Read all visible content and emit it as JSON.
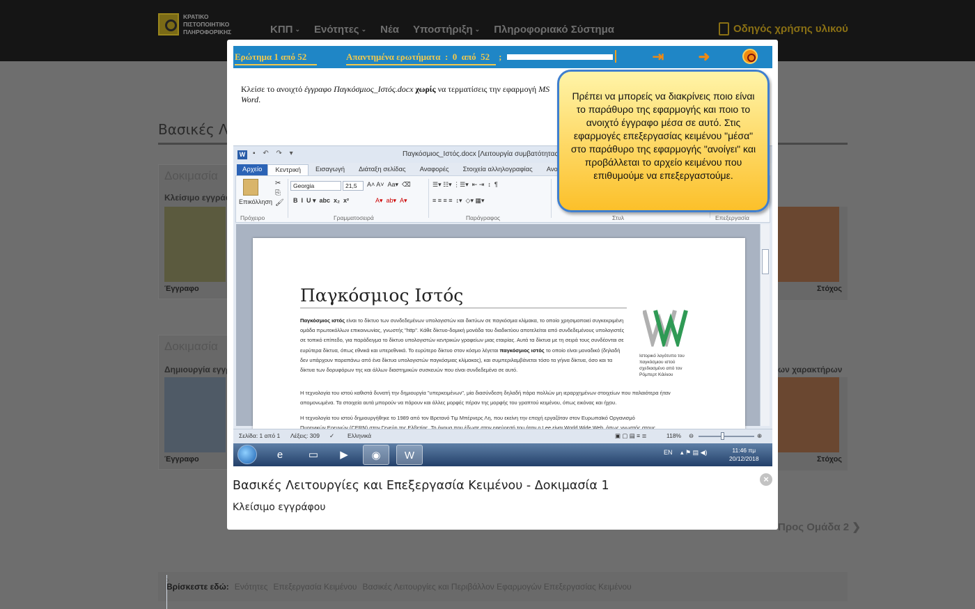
{
  "site": {
    "logo_text": "ΚΡΑΤΙΚΟ\nΠΙΣΤΟΠΟΙΗΤΙΚΟ\nΠΛΗΡΟΦΟΡΙΚΗΣ",
    "nav": [
      "ΚΠΠ",
      "Ενότητες",
      "Νέα",
      "Υποστήριξη",
      "Πληροφοριακό Σύστημα"
    ],
    "guide": "Οδηγός χρήσης υλικού",
    "section_title": "Βασικές Λε",
    "cards": [
      {
        "title": "Δοκιμασία",
        "subtitle": "Κλείσιμο εγγράφ",
        "footer": "Έγγραφο",
        "right_footer": "Στόχος"
      },
      {
        "title": "Δοκιμασία",
        "subtitle": "Δημιουργία εγγρ",
        "footer": "Έγγραφο",
        "right_label": "ων χαρακτήρων",
        "right_footer": "Στόχος"
      }
    ],
    "next_group": "Προς Ομάδα 2",
    "breadcrumb": {
      "label": "Βρίσκεστε εδώ:",
      "items": [
        "Ενότητες",
        "Επεξεργασία Κειμένου",
        "Βασικές Λειτουργίες και Περιβάλλον Εφαρμογών Επεξεργασίας Κειμένου"
      ]
    }
  },
  "modal": {
    "title": "Βασικές Λειτουργίες και Επεξεργασία Κειμένου - Δοκιμασία 1",
    "subtitle": "Κλείσιμο εγγράφου",
    "close_icon": "close-circle-icon",
    "quiz": {
      "question": "Ερώτημα 1 από 52",
      "answered": "Απαντημένα ερωτήματα  :  0  από  52    ;",
      "progress": 0,
      "instruction_pre": "Κλείσε το ανοιχτό ",
      "instruction_doc_word": "έγγραφο",
      "instruction_file": "Παγκόσμιος_Ιστός.docx",
      "instruction_bold": "χωρίς",
      "instruction_post": " να τερματίσεις την εφαρμογή ",
      "instruction_app": "MS Word",
      "tooltip": "Πρέπει να μπορείς να διακρίνεις ποιο είναι το παράθυρο της εφαρμογής και ποιο το ανοιχτό έγγραφο μέσα σε αυτό. Στις εφαρμογές επεξεργασίας κειμένου \"μέσα\" στο παράθυρο της εφαρμογής \"ανοίγει\" και προβάλλεται το αρχείο κειμένου που επιθυμούμε να επεξεργαστούμε."
    },
    "word": {
      "window_title": "Παγκόσμιος_Ιστός.docx [Λειτουργία συμβατότητας] -",
      "tabs": [
        "Αρχείο",
        "Κεντρική",
        "Εισαγωγή",
        "Διάταξη σελίδας",
        "Αναφορές",
        "Στοιχεία αλληλογραφίας",
        "Αναθε"
      ],
      "paste": "Επικόλληση",
      "font": "Georgia",
      "size": "21,5",
      "groups": [
        "Πρόχειρο",
        "Γραμματοσειρά",
        "Παράγραφος",
        "Στυλ",
        "Επεξεργασία"
      ],
      "doc_title": "Παγκόσμιος Ιστός",
      "p1_bold": "Παγκόσμιος ιστός",
      "p1": " είναι το δίκτυο των συνδεδεμένων υπολογιστών και δικτύων σε παγκόσμια κλίμακα, το οποίο χρησιμοποιεί συγκεκριμένη ομάδα πρωτοκόλλων επικοινωνίας, γνωστής \"http\". Κάθε δίκτυο-δομική μονάδα του διαδικτύου αποτελείται από συνδεδεμένους υπολογιστές σε τοπικό επίπεδο, για παράδειγμα το δίκτυο υπολογιστών κεντρικών γραφείων μιας εταιρίας. Αυτά τα δίκτυα με τη σειρά τους συνδέονται σε ευρύτερα δίκτυα, όπως εθνικά και υπερεθνικά. Το ευρύτερο δίκτυο στον κόσμο λέγεται ",
      "p1_bold2": "παγκόσμιος ιστός",
      "p1_end": " το οποίο είναι μοναδικό (δηλαδή δεν υπάρχουν παραπάνω από ένα δίκτυα υπολογιστών παγκόσμιας κλίμακας), και συμπεριλαμβάνεται τόσο τα γήινα δίκτυα, όσο και τα δίκτυα των δορυφόρων της και άλλων διαστημικών συσκευών που είναι συνδεδεμένα σε αυτό.",
      "p2": "Η τεχνολογία του ιστού καθιστά δυνατή την δημιουργία \"υπερκειμένων\", μία διασύνδεση δηλαδή πάρα πολλών μη ιεραρχημένων στοιχείων που παλαιότερα ήταν απομονωμένα. Τα στοιχεία αυτά μπορούν να πάρουν και άλλες μορφές πέραν της μορφής του γραπτού κειμένου, όπως εικόνας και ήχου.",
      "p3": "Η τεχνολογία του ιστού δημιουργήθηκε το 1989 από τον Βρετανό Τιμ Μπέρνερς Λη, που εκείνη την εποχή εργαζόταν στον Ευρωπαϊκό Οργανισμό",
      "p3b": "Πυρηνικών Ερευνών (CERN) στην Γενεύη της Ελβετίας. Το όνομα που έδωσε στην εφεύρεσή του ήταν ο Lee είναι World Wide Web, όπως γνωστός στους",
      "logo_caption": "Ιστορικό λογότυπο του παγκόσμιου ιστού σχεδιασμένο από τον Ρόμπερτ Κάιλιου",
      "status_page": "Σελίδα: 1 από 1",
      "status_words": "Λέξεις: 309",
      "status_lang": "Ελληνικά",
      "zoom": "118%"
    },
    "taskbar": {
      "lang": "EN",
      "time": "11:46 πμ",
      "date": "20/12/2018"
    }
  }
}
